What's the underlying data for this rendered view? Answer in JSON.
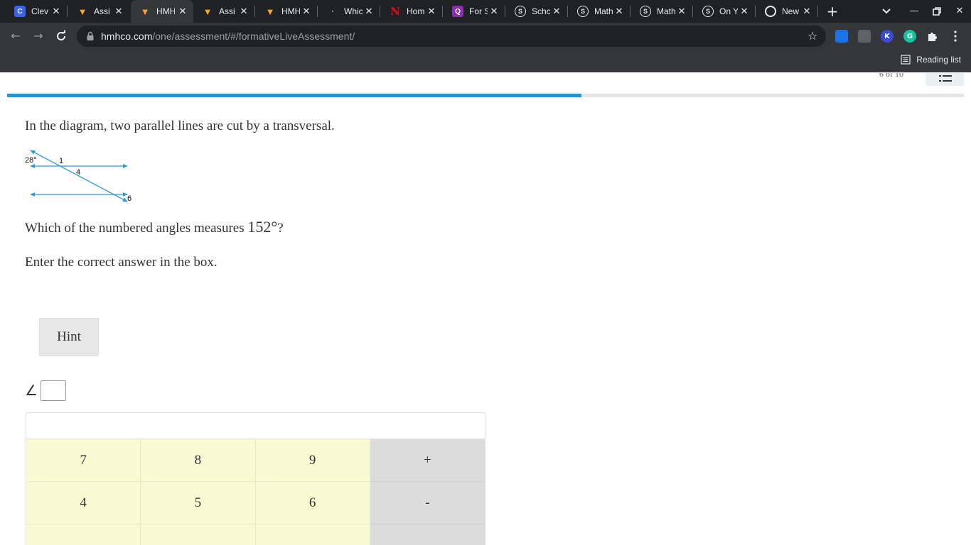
{
  "browser": {
    "tabs": [
      {
        "title": "Clev",
        "favicon": "C",
        "favicon_type": "clever-icon"
      },
      {
        "title": "Assi",
        "favicon": "",
        "favicon_type": "hmh-icon"
      },
      {
        "title": "HMH",
        "favicon": "",
        "favicon_type": "hmh-icon",
        "active": true
      },
      {
        "title": "Assi",
        "favicon": "",
        "favicon_type": "hmh-icon"
      },
      {
        "title": "HMH",
        "favicon": "",
        "favicon_type": "hmh-icon"
      },
      {
        "title": "Whic",
        "favicon": "",
        "favicon_type": "generic-page-icon"
      },
      {
        "title": "Hom",
        "favicon": "N",
        "favicon_type": "netflix-icon"
      },
      {
        "title": "For S",
        "favicon": "Q",
        "favicon_type": "quizlet-icon"
      },
      {
        "title": "Schc",
        "favicon": "S",
        "favicon_type": "s-circle-icon"
      },
      {
        "title": "Math",
        "favicon": "S",
        "favicon_type": "s-circle-icon"
      },
      {
        "title": "Math",
        "favicon": "S",
        "favicon_type": "s-circle-icon"
      },
      {
        "title": "On Y",
        "favicon": "S",
        "favicon_type": "s-circle-icon"
      },
      {
        "title": "New",
        "favicon": "",
        "favicon_type": "chrome-icon"
      }
    ],
    "url_host": "hmhco.com",
    "url_path": "/one/assessment/#/formativeLiveAssessment/",
    "reading_list_label": "Reading list",
    "extensions": [
      {
        "name": "screen-capture-extension-icon",
        "color": "#1a73e8",
        "glyph": ""
      },
      {
        "name": "printer-extension-icon",
        "color": "#5f6368",
        "glyph": ""
      },
      {
        "name": "k-extension-icon",
        "color": "#3b4bd8",
        "glyph": "K"
      },
      {
        "name": "grammarly-extension-icon",
        "color": "#15c39a",
        "glyph": "G"
      }
    ]
  },
  "assessment": {
    "question_counter": "6 of 10",
    "progress_fraction": 0.6,
    "progress_color": "#2e8fd1",
    "prompt": "In the diagram, two parallel lines are cut by a transversal.",
    "question_prefix": "Which of the numbered angles measures ",
    "question_value": "152°",
    "question_suffix": "?",
    "instruction": "Enter the correct answer in the box.",
    "hint_label": "Hint",
    "angle_symbol": "∠",
    "answer_value": "",
    "diagram": {
      "angle_label_given": "28°",
      "angle_label_a": "1",
      "angle_label_b": "4",
      "angle_label_c": "6",
      "line_color": "#2e9bd6"
    },
    "keypad": {
      "rows": [
        [
          "7",
          "8",
          "9",
          "+"
        ],
        [
          "4",
          "5",
          "6",
          "-"
        ],
        [
          "",
          "",
          "",
          ""
        ]
      ]
    }
  }
}
